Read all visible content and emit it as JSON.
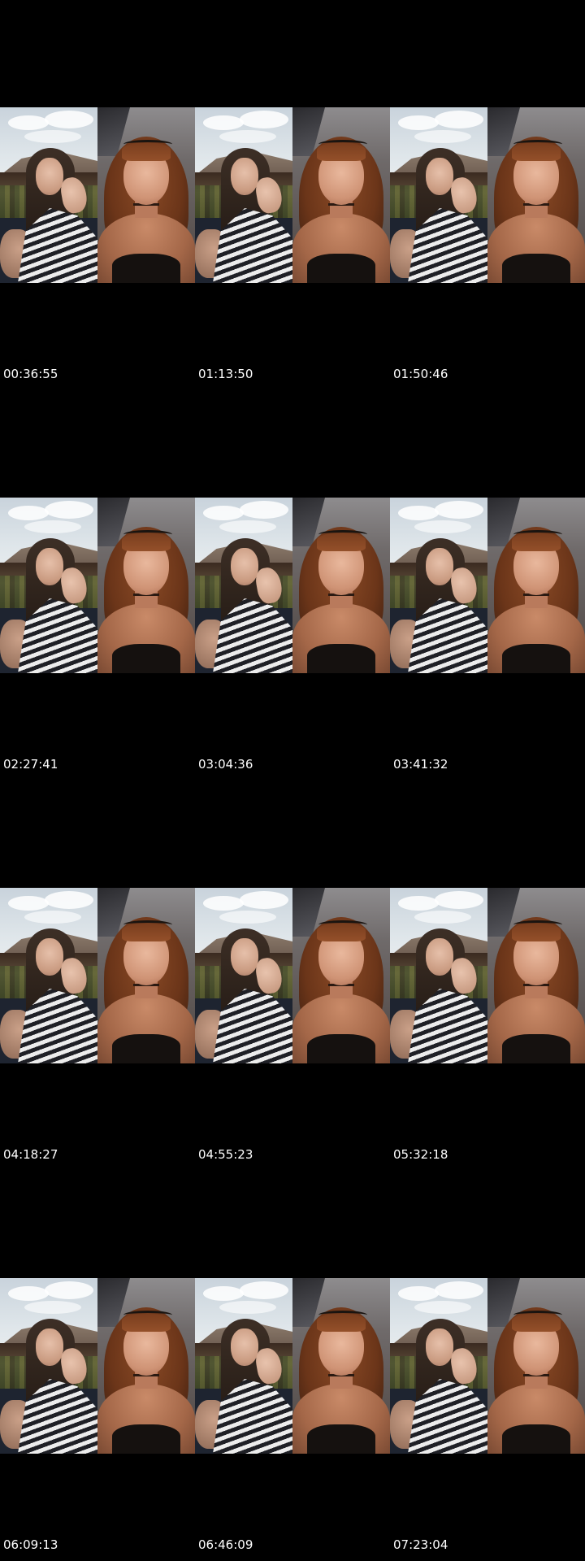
{
  "timestamps": [
    "00:36:55",
    "01:13:50",
    "01:50:46",
    "02:27:41",
    "03:04:36",
    "03:41:32",
    "04:18:27",
    "04:55:23",
    "05:32:18",
    "06:09:13",
    "06:46:09",
    "07:23:04"
  ],
  "colors": {
    "background": "#000000",
    "timestamp_text": "#ffffff"
  }
}
